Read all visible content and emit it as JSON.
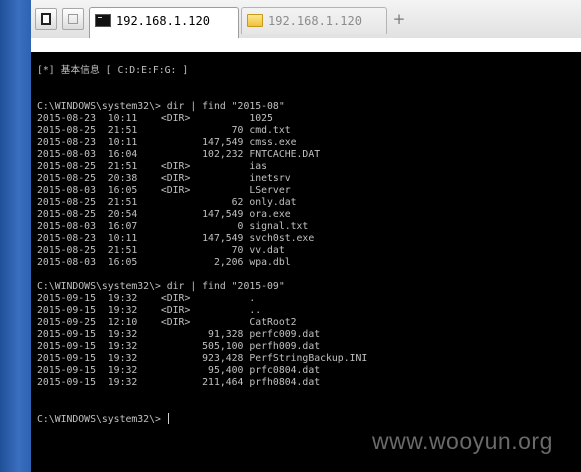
{
  "toolbar": {
    "buttons": [
      "window-button",
      "blank-button"
    ]
  },
  "tabs": [
    {
      "label": "192.168.1.120",
      "icon": "terminal-icon",
      "active": true
    },
    {
      "label": "192.168.1.120",
      "icon": "folder-icon",
      "active": false
    }
  ],
  "new_tab_label": "+",
  "terminal": {
    "lines": [
      "[*] 基本信息 [ C:D:E:F:G: ]",
      "",
      "C:\\WINDOWS\\system32\\> dir | find \"2015-08\"",
      "2015-08-23  10:11    <DIR>          1025",
      "2015-08-25  21:51                70 cmd.txt",
      "2015-08-23  10:11           147,549 cmss.exe",
      "2015-08-03  16:04           102,232 FNTCACHE.DAT",
      "2015-08-25  21:51    <DIR>          ias",
      "2015-08-25  20:38    <DIR>          inetsrv",
      "2015-08-03  16:05    <DIR>          LServer",
      "2015-08-25  21:51                62 only.dat",
      "2015-08-25  20:54           147,549 ora.exe",
      "2015-08-03  16:07                 0 signal.txt",
      "2015-08-23  10:11           147,549 svch0st.exe",
      "2015-08-25  21:51                70 vv.dat",
      "2015-08-03  16:05             2,206 wpa.dbl",
      "",
      "C:\\WINDOWS\\system32\\> dir | find \"2015-09\"",
      "2015-09-15  19:32    <DIR>          .",
      "2015-09-15  19:32    <DIR>          ..",
      "2015-09-25  12:10    <DIR>          CatRoot2",
      "2015-09-15  19:32            91,328 perfc009.dat",
      "2015-09-15  19:32           505,100 perfh009.dat",
      "2015-09-15  19:32           923,428 PerfStringBackup.INI",
      "2015-09-15  19:32            95,400 prfc0804.dat",
      "2015-09-15  19:32           211,464 prfh0804.dat"
    ],
    "prompt": "C:\\WINDOWS\\system32\\> "
  },
  "watermark": "www.wooyun.org"
}
